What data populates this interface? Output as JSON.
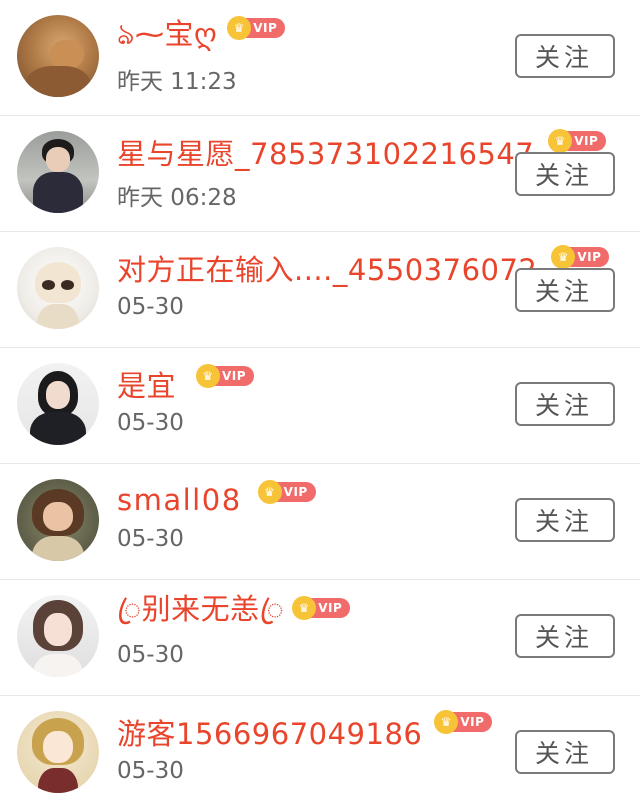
{
  "follow_label": "关注",
  "vip_label": "VIP",
  "colors": {
    "name": "#e8452c",
    "vip_badge": "#f26b6b",
    "vip_crown": "#f7c337",
    "time": "#666666",
    "divider": "#e8e8e8"
  },
  "users": [
    {
      "name": "ঌ⁓宝ღ",
      "time": "昨天 11:23",
      "vip": true,
      "avatar": "dog-avatar"
    },
    {
      "name": "星与星愿_785373102216547",
      "time": "昨天 06:28",
      "vip": true,
      "avatar": "man-avatar"
    },
    {
      "name": "对方正在输入...._4550376072",
      "time": "05-30",
      "vip": true,
      "avatar": "toy-bear-avatar"
    },
    {
      "name": "是宜",
      "time": "05-30",
      "vip": true,
      "avatar": "woman-avatar"
    },
    {
      "name": "small08",
      "time": "05-30",
      "vip": true,
      "avatar": "girl-avatar"
    },
    {
      "name": "ꦿ别来无恙ꦿ",
      "time": "05-30",
      "vip": true,
      "avatar": "woman-selfie-avatar"
    },
    {
      "name": "游客1566967049186",
      "time": "05-30",
      "vip": true,
      "avatar": "anime-avatar"
    }
  ]
}
